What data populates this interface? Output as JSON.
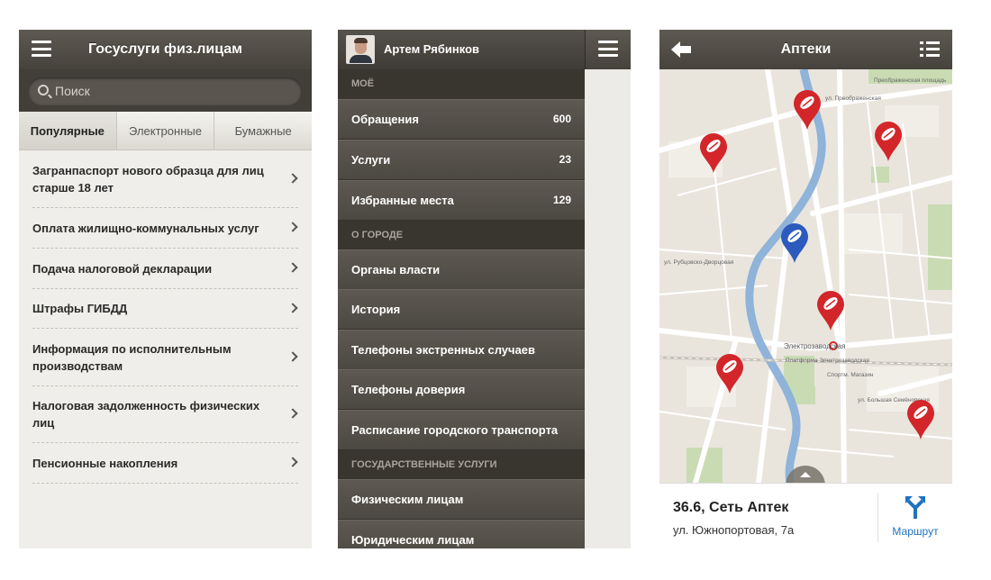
{
  "screen1": {
    "title": "Госуслуги физ.лицам",
    "search_placeholder": "Поиск",
    "tabs": [
      "Популярные",
      "Электронные",
      "Бумажные"
    ],
    "items": [
      "Загранпаспорт нового образца для лиц старше 18 лет",
      "Оплата жилищно-коммунальных услуг",
      "Подача налоговой декларации",
      "Штрафы ГИБДД",
      "Информация по исполнительным производствам",
      "Налоговая задолженность физических лиц",
      "Пенсионные накопления"
    ]
  },
  "screen2": {
    "user_name": "Артем Рябинков",
    "section_my": "МОЁ",
    "my_items": [
      {
        "label": "Обращения",
        "count": "600"
      },
      {
        "label": "Услуги",
        "count": "23"
      },
      {
        "label": "Избранные места",
        "count": "129"
      }
    ],
    "section_city": "О ГОРОДЕ",
    "city_items": [
      "Органы власти",
      "История",
      "Телефоны экстренных случаев",
      "Телефоны доверия",
      "Расписание городского транспорта"
    ],
    "section_gov": "ГОСУДАРСТВЕННЫЕ УСЛУГИ",
    "gov_items": [
      "Физическим лицам",
      "Юридическим лицам"
    ]
  },
  "screen3": {
    "title": "Аптеки",
    "place_name": "36.6, Сеть Аптек",
    "place_address": "ул. Южнопортовая, 7а",
    "route_label": "Маршрут",
    "map_labels": {
      "station_1": "Электрозаводская",
      "station_2": "Платформа Электрозаводская",
      "street_1": "ул. Преображенская",
      "street_2": "ул. Большая Семёновская",
      "square": "Преображенская площадь",
      "street_3": "ул. Рубцовско-Дворцовая",
      "street_4": "Спортм. Магазин"
    },
    "colors": {
      "pin_red": "#d3262a",
      "pin_blue": "#2c5bbd",
      "river": "#8fb3d9",
      "route_blue": "#1e73be"
    }
  }
}
